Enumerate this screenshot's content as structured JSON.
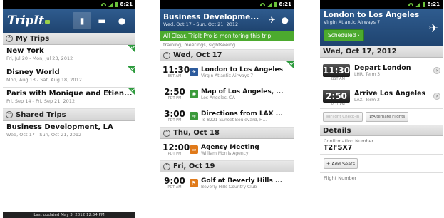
{
  "status_bar": {
    "time": "8:21"
  },
  "screen1": {
    "logo": "TripIt",
    "my_trips_label": "My Trips",
    "trips": [
      {
        "name": "New York",
        "dates": "Fri, Jul 20 - Mon, Jul 23, 2012"
      },
      {
        "name": "Disney World",
        "dates": "Mon, Aug 13 - Sat, Aug 18, 2012"
      },
      {
        "name": "Paris with Monique and Etien...",
        "dates": "Fri, Sep 14 - Fri, Sep 21, 2012"
      }
    ],
    "shared_trips_label": "Shared Trips",
    "shared": [
      {
        "name": "Business Development, LA",
        "dates": "Wed, Oct 17 - Sun, Oct 21, 2012"
      }
    ],
    "footer": "Last updated May 3, 2012 12:54 PM"
  },
  "screen2": {
    "title": "Business Developme...",
    "subtitle": "Wed, Oct 17 - Sun, Oct 21, 2012",
    "all_clear": "All Clear. TripIt Pro is monitoring this trip.",
    "tags": "training, meetings, sightseeing",
    "days": [
      {
        "label": "Wed, Oct 17",
        "events": [
          {
            "time": "11:30",
            "tz": "EST AM",
            "title": "London to Los Angeles",
            "sub": "Virgin Atlantic Airways 7",
            "icon": "plane-icon",
            "color": "#2c5a9c"
          },
          {
            "time": "2:50",
            "tz": "PDT PM",
            "title": "Map of Los Angeles, ...",
            "sub": "Los Angeles, CA",
            "icon": "map-pin-icon",
            "color": "#3a9a3a"
          },
          {
            "time": "3:00",
            "tz": "PDT PM",
            "title": "Directions from LAX ...",
            "sub": "To 8221 Sunset Boulevard, H...",
            "icon": "directions-icon",
            "color": "#3a9a3a"
          }
        ]
      },
      {
        "label": "Thu, Oct 18",
        "events": [
          {
            "time": "12:00",
            "tz": "PDT PM",
            "title": "Agency Meeting",
            "sub": "William Morris Agency",
            "icon": "meeting-icon",
            "color": "#e07a1a"
          }
        ]
      },
      {
        "label": "Fri, Oct 19",
        "events": [
          {
            "time": "9:00",
            "tz": "PDT AM",
            "title": "Golf at Beverly Hills ...",
            "sub": "Beverly Hills Country Club",
            "icon": "golf-icon",
            "color": "#e07a1a"
          }
        ]
      }
    ]
  },
  "screen3": {
    "title": "London to Los Angeles",
    "subtitle": "Virgin Atlantic Airways 7",
    "scheduled": "Scheduled",
    "date": "Wed, Oct 17, 2012",
    "depart": {
      "time": "11:30",
      "tz": "BST AM",
      "title": "Depart London",
      "sub": "LHR, Term 3"
    },
    "arrive": {
      "time": "2:50",
      "tz": "PDT PM",
      "title": "Arrive Los Angeles",
      "sub": "LAX, Term 2"
    },
    "flight_checkin": "Flight Check-In",
    "alternate_flights": "Alternate Flights",
    "details_label": "Details",
    "confirmation_label": "Confirmation Number",
    "confirmation_value": "T2FSX7",
    "add_seats": "+ Add Seats",
    "flight_number_label": "Flight Number"
  }
}
